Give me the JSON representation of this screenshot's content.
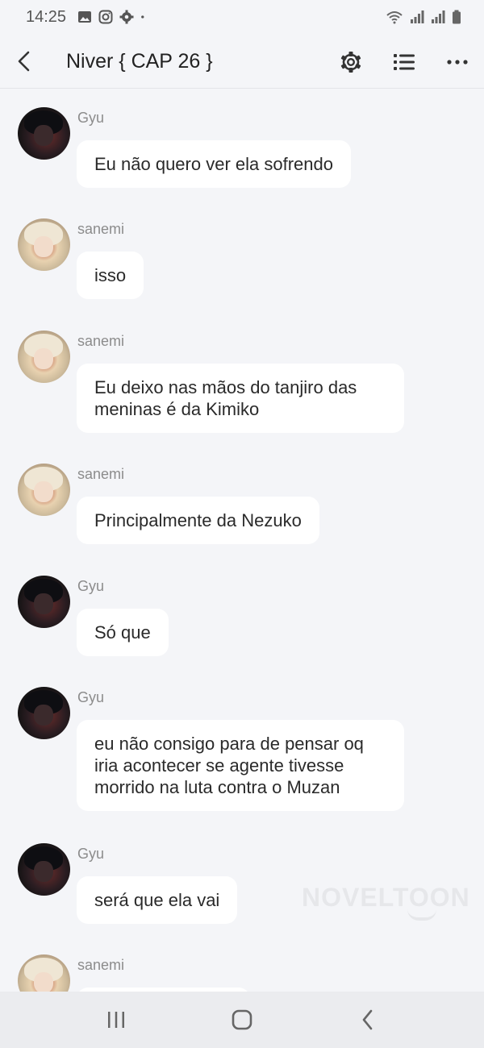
{
  "status_bar": {
    "time": "14:25",
    "left_icons": [
      "image-icon",
      "instagram-icon",
      "gear-icon",
      "dot-icon"
    ],
    "right_icons": [
      "wifi-icon",
      "signal-icon",
      "signal-icon",
      "battery-icon"
    ]
  },
  "header": {
    "title": "Niver { CAP 26 }",
    "back_icon": "chevron-left-icon",
    "actions": [
      "settings-icon",
      "list-icon",
      "more-icon"
    ]
  },
  "messages": [
    {
      "sender": "Gyu",
      "avatar": "gyu",
      "text": "Eu não quero ver ela sofrendo"
    },
    {
      "sender": "sanemi",
      "avatar": "sanemi",
      "text": "isso"
    },
    {
      "sender": "sanemi",
      "avatar": "sanemi",
      "line1": "Eu deixo nas mãos do tanjiro das",
      "line2": "meninas é da Kimiko"
    },
    {
      "sender": "sanemi",
      "avatar": "sanemi",
      "text": "Principalmente da Nezuko"
    },
    {
      "sender": "Gyu",
      "avatar": "gyu",
      "text": "Só que"
    },
    {
      "sender": "Gyu",
      "avatar": "gyu",
      "line1": "eu não consigo para de pensar oq",
      "line2": "iria acontecer se agente tivesse",
      "line3": "morrido na luta contra o Muzan"
    },
    {
      "sender": "Gyu",
      "avatar": "gyu",
      "text": "será que ela vai"
    },
    {
      "sender": "sanemi",
      "avatar": "sanemi",
      "text": ""
    }
  ],
  "watermark": "NOVELTOON",
  "nav": [
    "recent-apps-icon",
    "home-icon",
    "back-icon"
  ],
  "colors": {
    "background": "#f4f5f8",
    "bubble": "#ffffff",
    "name": "#8c8c8c"
  }
}
